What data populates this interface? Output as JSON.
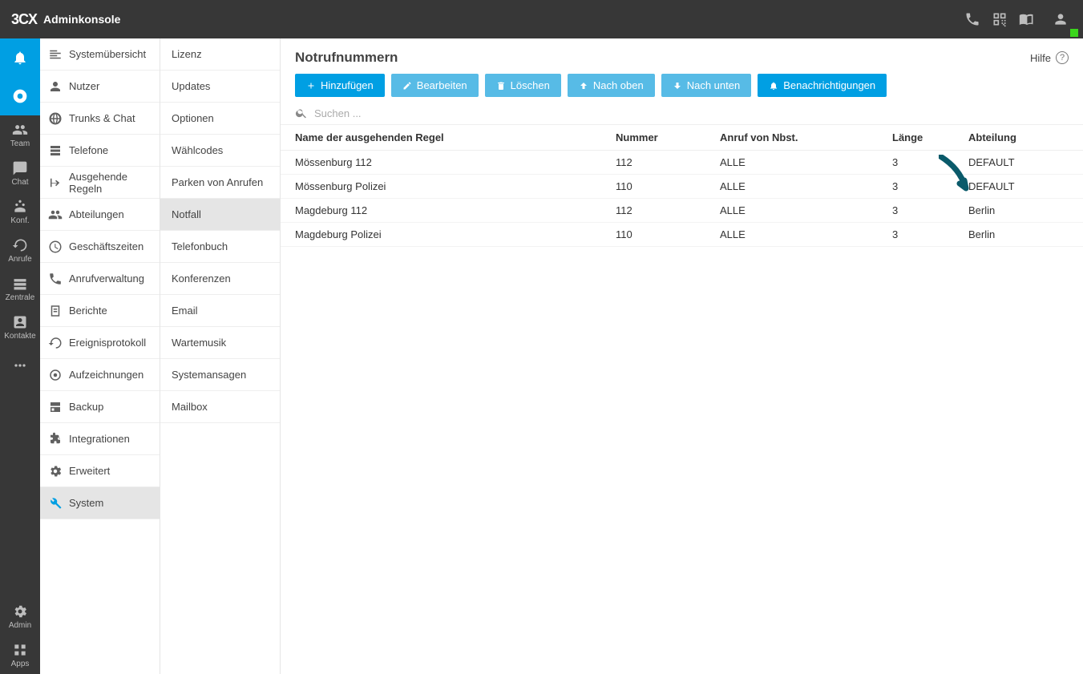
{
  "header": {
    "logo": "3CX",
    "app_name": "Adminkonsole"
  },
  "rail": {
    "items": [
      {
        "key": "bell",
        "label": "",
        "icon": "bell",
        "active": true
      },
      {
        "key": "chrome",
        "label": "",
        "icon": "chrome",
        "active": true
      },
      {
        "key": "team",
        "label": "Team",
        "icon": "people"
      },
      {
        "key": "chat",
        "label": "Chat",
        "icon": "chat"
      },
      {
        "key": "konf",
        "label": "Konf.",
        "icon": "conf"
      },
      {
        "key": "anrufe",
        "label": "Anrufe",
        "icon": "history"
      },
      {
        "key": "zentrale",
        "label": "Zentrale",
        "icon": "panel"
      },
      {
        "key": "kontakte",
        "label": "Kontakte",
        "icon": "contact"
      },
      {
        "key": "more",
        "label": "",
        "icon": "more"
      }
    ],
    "footer": [
      {
        "key": "admin",
        "label": "Admin",
        "icon": "gear"
      },
      {
        "key": "apps",
        "label": "Apps",
        "icon": "apps"
      }
    ]
  },
  "nav1": {
    "items": [
      {
        "label": "Systemübersicht",
        "icon": "dashboard"
      },
      {
        "label": "Nutzer",
        "icon": "user"
      },
      {
        "label": "Trunks & Chat",
        "icon": "globe"
      },
      {
        "label": "Telefone",
        "icon": "phones"
      },
      {
        "label": "Ausgehende Regeln",
        "icon": "outbound"
      },
      {
        "label": "Abteilungen",
        "icon": "departments"
      },
      {
        "label": "Geschäftszeiten",
        "icon": "clock"
      },
      {
        "label": "Anrufverwaltung",
        "icon": "callhandle"
      },
      {
        "label": "Berichte",
        "icon": "report"
      },
      {
        "label": "Ereignisprotokoll",
        "icon": "eventlog"
      },
      {
        "label": "Aufzeichnungen",
        "icon": "record"
      },
      {
        "label": "Backup",
        "icon": "backup"
      },
      {
        "label": "Integrationen",
        "icon": "puzzle"
      },
      {
        "label": "Erweitert",
        "icon": "gear2"
      },
      {
        "label": "System",
        "icon": "wrench",
        "active": true
      }
    ]
  },
  "nav2": {
    "items": [
      {
        "label": "Lizenz"
      },
      {
        "label": "Updates"
      },
      {
        "label": "Optionen"
      },
      {
        "label": "Wählcodes"
      },
      {
        "label": "Parken von Anrufen"
      },
      {
        "label": "Notfall",
        "active": true
      },
      {
        "label": "Telefonbuch"
      },
      {
        "label": "Konferenzen"
      },
      {
        "label": "Email"
      },
      {
        "label": "Wartemusik"
      },
      {
        "label": "Systemansagen"
      },
      {
        "label": "Mailbox"
      }
    ]
  },
  "main": {
    "title": "Notrufnummern",
    "help": "Hilfe",
    "toolbar": {
      "add": "Hinzufügen",
      "edit": "Bearbeiten",
      "delete": "Löschen",
      "up": "Nach oben",
      "down": "Nach unten",
      "notify": "Benachrichtigungen"
    },
    "search_placeholder": "Suchen ...",
    "columns": {
      "name": "Name der ausgehenden Regel",
      "number": "Nummer",
      "from": "Anruf von Nbst.",
      "length": "Länge",
      "dept": "Abteilung"
    },
    "rows": [
      {
        "name": "Mössenburg 112",
        "number": "112",
        "from": "ALLE",
        "length": "3",
        "dept": "DEFAULT"
      },
      {
        "name": "Mössenburg Polizei",
        "number": "110",
        "from": "ALLE",
        "length": "3",
        "dept": "DEFAULT"
      },
      {
        "name": "Magdeburg 112",
        "number": "112",
        "from": "ALLE",
        "length": "3",
        "dept": "Berlin"
      },
      {
        "name": "Magdeburg Polizei",
        "number": "110",
        "from": "ALLE",
        "length": "3",
        "dept": "Berlin"
      }
    ]
  }
}
